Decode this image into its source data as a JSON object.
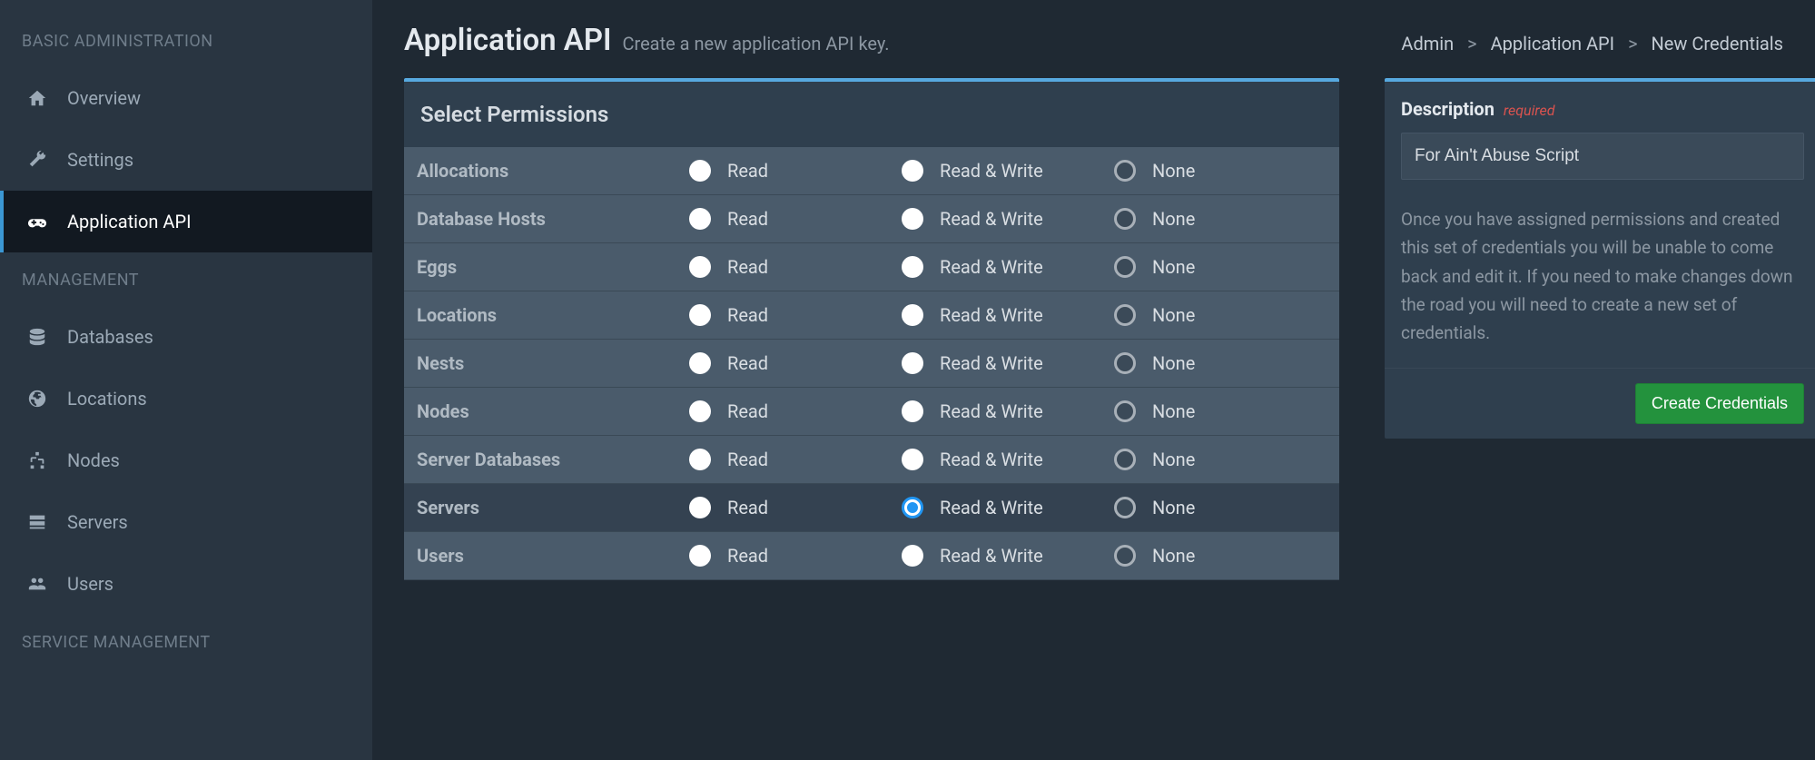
{
  "page": {
    "title": "Application API",
    "subtitle": "Create a new application API key."
  },
  "breadcrumbs": {
    "admin": "Admin",
    "app_api": "Application API",
    "new_creds": "New Credentials"
  },
  "sidebar": {
    "headings": {
      "basic": "BASIC ADMINISTRATION",
      "management": "MANAGEMENT",
      "service": "SERVICE MANAGEMENT"
    },
    "items": {
      "overview": "Overview",
      "settings": "Settings",
      "app_api": "Application API",
      "databases": "Databases",
      "locations": "Locations",
      "nodes": "Nodes",
      "servers": "Servers",
      "users": "Users"
    }
  },
  "permissions": {
    "panel_title": "Select Permissions",
    "columns": {
      "read": "Read",
      "read_write": "Read & Write",
      "none": "None"
    },
    "rows": [
      {
        "name": "Allocations",
        "selected": "none"
      },
      {
        "name": "Database Hosts",
        "selected": "none"
      },
      {
        "name": "Eggs",
        "selected": "none"
      },
      {
        "name": "Locations",
        "selected": "none"
      },
      {
        "name": "Nests",
        "selected": "none"
      },
      {
        "name": "Nodes",
        "selected": "none"
      },
      {
        "name": "Server Databases",
        "selected": "none"
      },
      {
        "name": "Servers",
        "selected": "read_write"
      },
      {
        "name": "Users",
        "selected": "none"
      }
    ]
  },
  "description": {
    "label": "Description",
    "required": "required",
    "value": "For Ain't Abuse Script",
    "help": "Once you have assigned permissions and created this set of credentials you will be unable to come back and edit it. If you need to make changes down the road you will need to create a new set of credentials.",
    "button": "Create Credentials"
  }
}
